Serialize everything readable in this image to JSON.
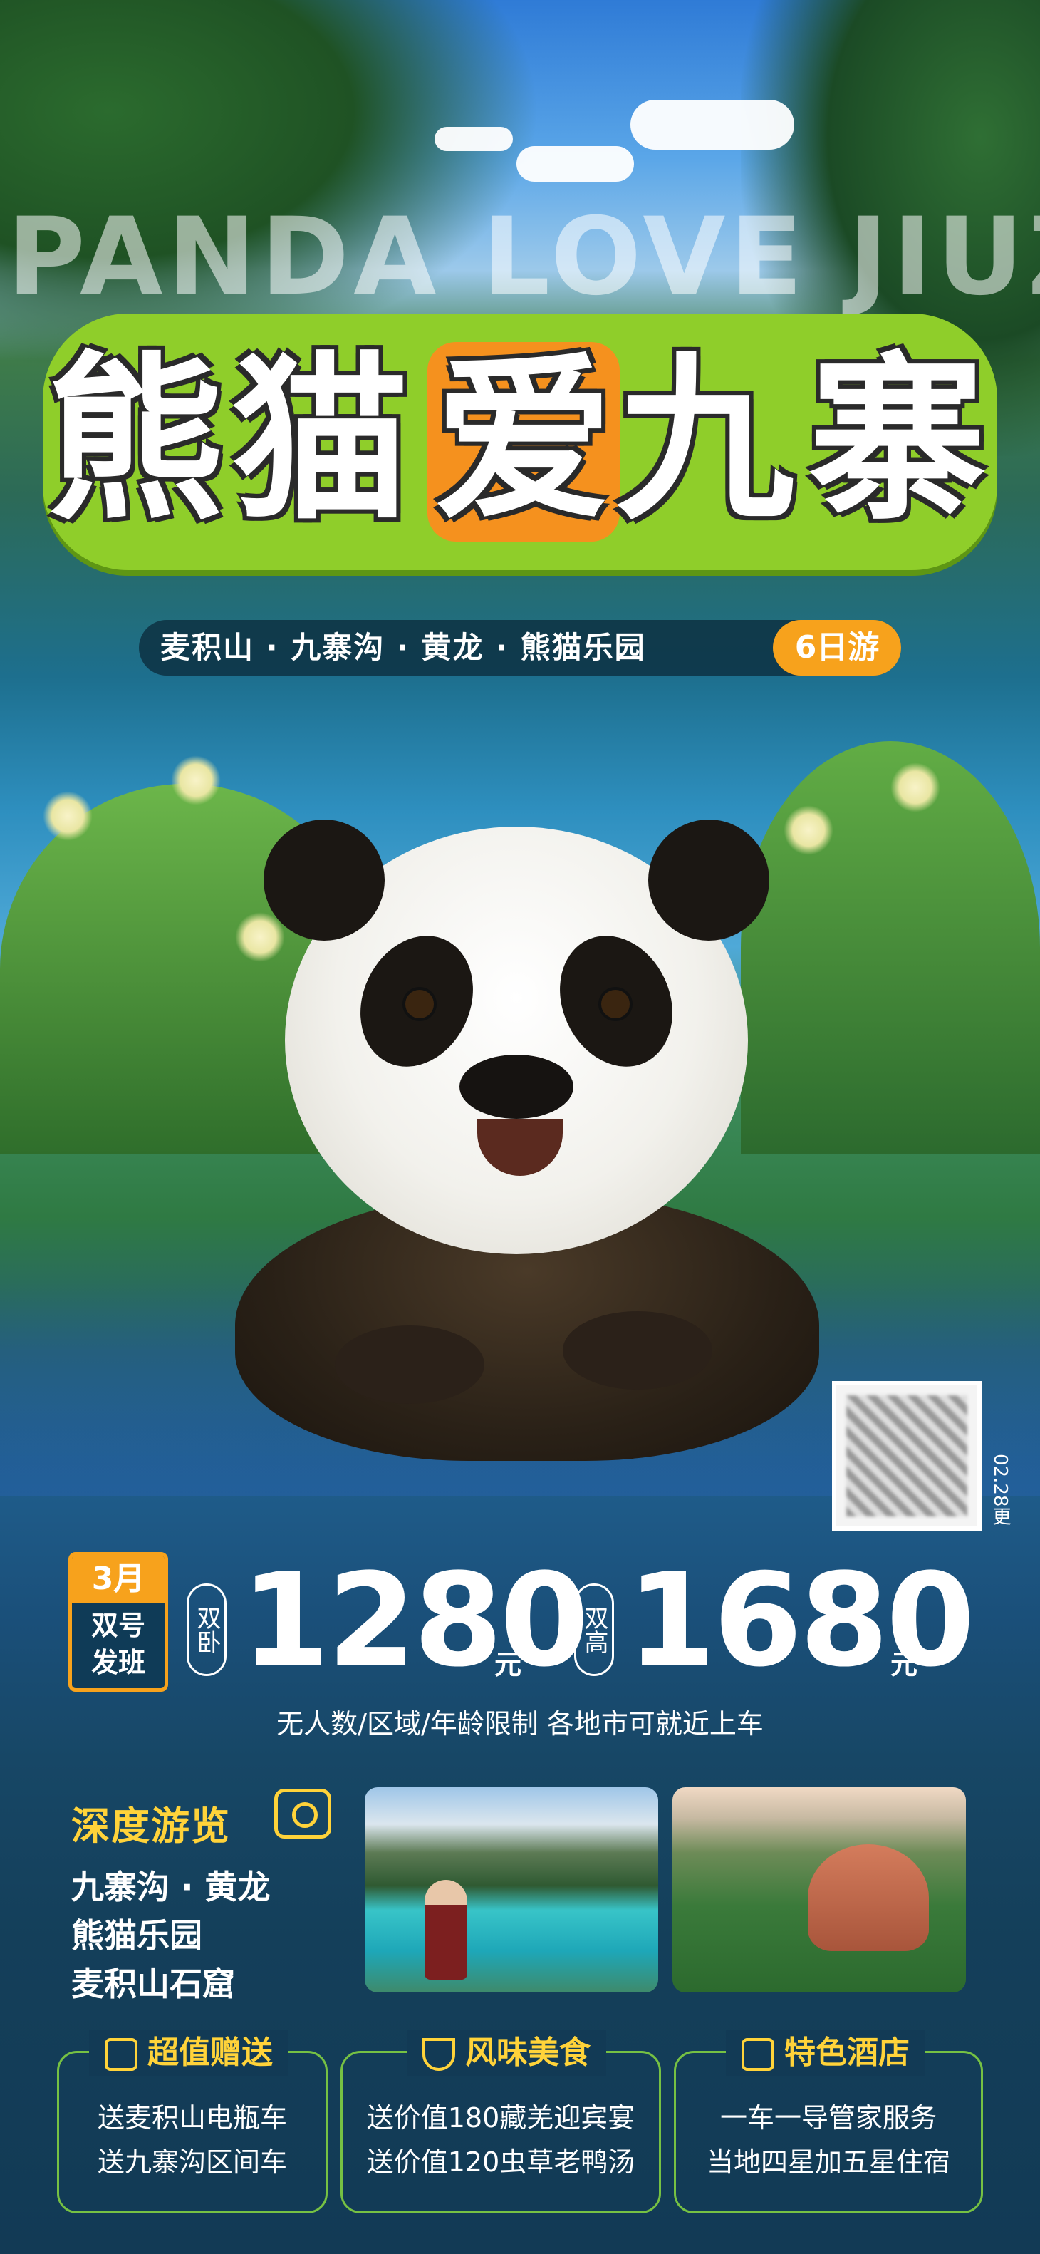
{
  "header": {
    "english_title": "PANDA LOVE JIUZHAI",
    "title_chars": [
      "熊",
      "猫",
      "爱",
      "九",
      "寨"
    ]
  },
  "route": {
    "text": "麦积山 · 九寨沟 · 黄龙 · 熊猫乐园",
    "days": "6日游"
  },
  "qr": {
    "date_code": "02.28更"
  },
  "departure": {
    "month": "3月",
    "line1": "双号",
    "line2": "发班"
  },
  "prices": [
    {
      "tag": "双卧",
      "value": "1280",
      "unit": "元"
    },
    {
      "tag": "双高",
      "value": "1680",
      "unit": "元"
    }
  ],
  "notice": "无人数/区域/年龄限制  各地市可就近上车",
  "highlights": {
    "title": "深度游览",
    "lines": [
      "九寨沟 · 黄龙",
      "熊猫乐园",
      "麦积山石窟"
    ]
  },
  "features": [
    {
      "title": "超值赠送",
      "icon": "gift-icon",
      "lines": [
        "送麦积山电瓶车",
        "送九寨沟区间车"
      ]
    },
    {
      "title": "风味美食",
      "icon": "food-bowl-icon",
      "lines": [
        "送价值180藏羌迎宾宴",
        "送价值120虫草老鸭汤"
      ]
    },
    {
      "title": "特色酒店",
      "icon": "hotel-icon",
      "lines": [
        "一车一导管家服务",
        "当地四星加五星住宿"
      ]
    }
  ],
  "colors": {
    "accent_orange": "#f7a21c",
    "title_green": "#8fce2a",
    "highlight_yellow": "#ffd33a",
    "feature_border": "#76c143",
    "bottom_bg": "#123a55"
  }
}
